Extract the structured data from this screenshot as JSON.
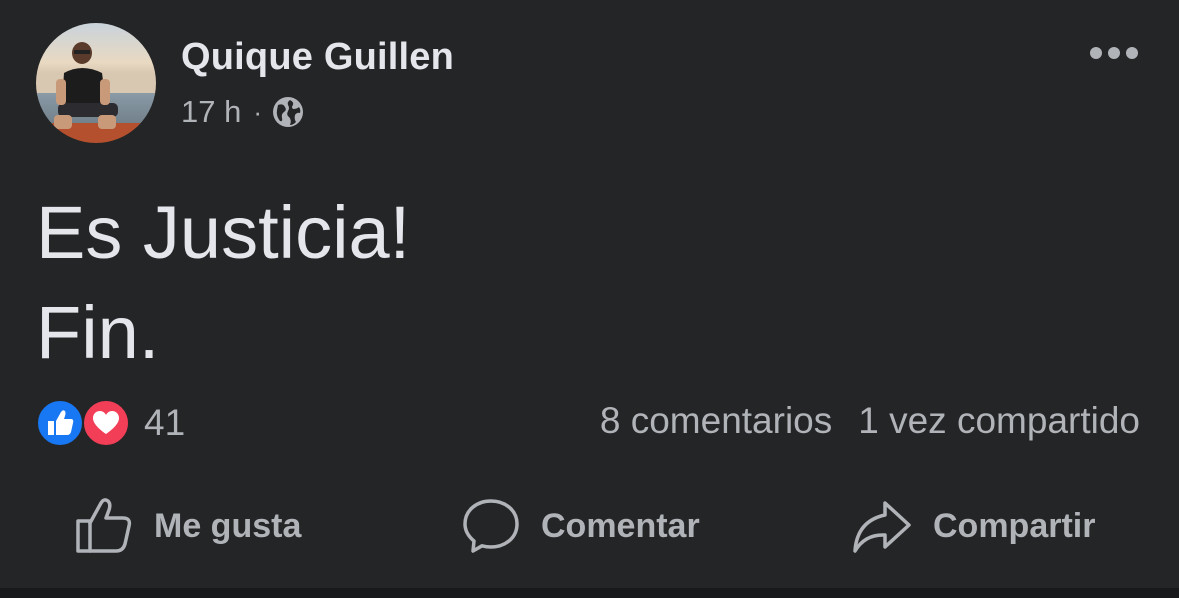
{
  "post": {
    "author": "Quique Guillen",
    "time": "17 h",
    "separator": "·",
    "privacy_icon": "globe-icon",
    "menu_icon": "more-horizontal-icon",
    "text_lines": [
      "Es Justicia!",
      "Fin."
    ]
  },
  "stats": {
    "reaction_icons": [
      "like-reaction-icon",
      "love-reaction-icon"
    ],
    "reaction_count": "41",
    "comments": "8 comentarios",
    "shares": "1 vez compartido"
  },
  "actions": {
    "like": {
      "label": "Me gusta",
      "icon": "thumbs-up-icon"
    },
    "comment": {
      "label": "Comentar",
      "icon": "comment-bubble-icon"
    },
    "share": {
      "label": "Compartir",
      "icon": "share-arrow-icon"
    }
  },
  "colors": {
    "background": "#242526",
    "primary_text": "#e4e6eb",
    "secondary_text": "#b0b3b8",
    "like_blue": "#1877f2",
    "love_red": "#f33e58"
  }
}
